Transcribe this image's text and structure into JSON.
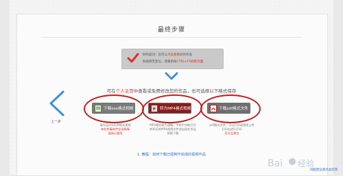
{
  "page": {
    "title": "最终步骤",
    "message": {
      "line1_prefix": "制作成功！您可以",
      "line1_link": "点此查看",
      "line1_suffix": "您的作品",
      "line2_prefix": "如视频无变化，请重新按",
      "line2_red": "CTRL+F5刷新页面"
    },
    "instruction": {
      "prefix": "可在",
      "link": "个人主页",
      "suffix": "中查看或免费修改您的作品，也可选择以下格式保存"
    },
    "back": {
      "label": "上一步"
    },
    "buttons": [
      {
        "label": "下载exe格式视频",
        "icon": "exe-file-icon"
      },
      {
        "label": "转为MP4格式视频",
        "icon": "mp4-file-icon"
      },
      {
        "label": "下载pdf格式文件",
        "icon": "pdf-file-icon"
      }
    ],
    "descriptions": [
      {
        "line1": "该作品exe文件格式视频",
        "line2": "有些杀毒软件会误报毒",
        "line3": "请放心使用"
      },
      {
        "line1": "MP4格式较为清晰，手机中亦能打开",
        "line2": "转码后的MP4视频文件会出现在作品",
        "line3": "视频下载"
      },
      {
        "line1": "pdf格式文件，可以打印或直接上传",
        "line2": "打印店进行打印",
        "line3": "可作品预览"
      }
    ],
    "tip": "1. 教程：如何下载已经制作完成的视频作品",
    "footer_link": "问题建议请点此反馈",
    "watermark_text": "Bai 经验"
  }
}
